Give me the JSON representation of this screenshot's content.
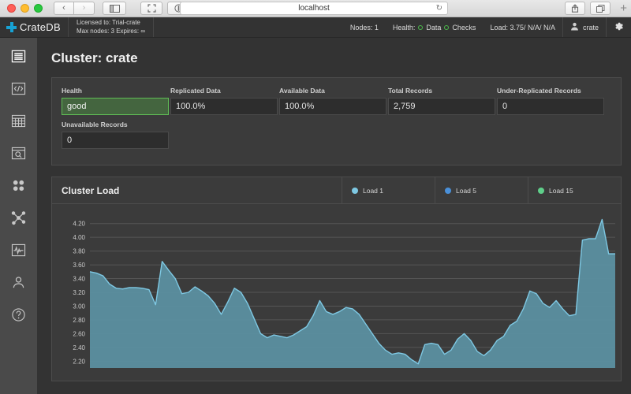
{
  "browser": {
    "url": "localhost",
    "back_icon": "‹",
    "forward_icon": "›",
    "sidebar_icon": "sidebar",
    "fullscreen_icon": "expand",
    "reader_icon": "reader",
    "reload_icon": "↻",
    "share_icon": "share",
    "tabs_icon": "tabs",
    "new_tab_icon": "+"
  },
  "appbar": {
    "logo_text": "CrateDB",
    "license_line1": "Licensed to: Trial-crate",
    "license_line2": "Max nodes: 3 Expires: ∞",
    "nodes": "Nodes: 1",
    "health_label": "Health:",
    "health_data": "Data",
    "health_checks": "Checks",
    "load": "Load: 3.75/ N/A/ N/A",
    "user": "crate",
    "gear_icon": "gear-icon",
    "ok_color": "#4cbb4c",
    "brand_color": "#17a2d4"
  },
  "sidebar": {
    "items": [
      {
        "name": "overview",
        "icon": "overview-icon",
        "active": true
      },
      {
        "name": "console",
        "icon": "code-console-icon",
        "active": false
      },
      {
        "name": "tables",
        "icon": "table-grid-icon",
        "active": false
      },
      {
        "name": "query-inspector",
        "icon": "search-window-icon",
        "active": false
      },
      {
        "name": "nodes",
        "icon": "four-dots-icon",
        "active": false
      },
      {
        "name": "shards",
        "icon": "network-nodes-icon",
        "active": false
      },
      {
        "name": "monitoring",
        "icon": "pulse-chart-icon",
        "active": false
      },
      {
        "name": "user",
        "icon": "user-icon",
        "active": false
      },
      {
        "name": "help",
        "icon": "help-circle-icon",
        "active": false
      }
    ]
  },
  "page": {
    "title": "Cluster: crate"
  },
  "stats": [
    {
      "label": "Health",
      "value": "good",
      "status": "good"
    },
    {
      "label": "Replicated Data",
      "value": "100.0%",
      "status": "normal"
    },
    {
      "label": "Available Data",
      "value": "100.0%",
      "status": "normal"
    },
    {
      "label": "Total Records",
      "value": "2,759",
      "status": "normal"
    },
    {
      "label": "Under-Replicated Records",
      "value": "0",
      "status": "normal"
    },
    {
      "label": "Unavailable Records",
      "value": "0",
      "status": "normal"
    }
  ],
  "chart_panel": {
    "title": "Cluster Load",
    "legend": [
      {
        "label": "Load 1",
        "color": "#7ec8e3"
      },
      {
        "label": "Load 5",
        "color": "#4a90d9"
      },
      {
        "label": "Load 15",
        "color": "#5fcf8a"
      }
    ]
  },
  "chart_data": {
    "type": "area",
    "title": "Cluster Load",
    "xlabel": "",
    "ylabel": "",
    "ylim": [
      2.1,
      4.3
    ],
    "yticks": [
      2.2,
      2.4,
      2.6,
      2.8,
      3.0,
      3.2,
      3.4,
      3.6,
      3.8,
      4.0,
      4.2
    ],
    "ytick_labels": [
      "2.20",
      "2.40",
      "2.60",
      "2.80",
      "3.00",
      "3.20",
      "3.40",
      "3.60",
      "3.80",
      "4.00",
      "4.20"
    ],
    "grid": true,
    "legend_position": "top-right",
    "series": [
      {
        "name": "Load 1",
        "color": "#7ec8e3",
        "fill": "#5b8fa0",
        "values": [
          3.5,
          3.48,
          3.44,
          3.32,
          3.26,
          3.25,
          3.27,
          3.27,
          3.26,
          3.24,
          3.02,
          3.65,
          3.52,
          3.4,
          3.18,
          3.2,
          3.28,
          3.22,
          3.15,
          3.04,
          2.88,
          3.06,
          3.26,
          3.2,
          3.04,
          2.82,
          2.6,
          2.54,
          2.58,
          2.56,
          2.54,
          2.58,
          2.64,
          2.7,
          2.86,
          3.08,
          2.92,
          2.88,
          2.92,
          2.98,
          2.96,
          2.88,
          2.74,
          2.6,
          2.46,
          2.36,
          2.3,
          2.32,
          2.3,
          2.22,
          2.16,
          2.44,
          2.46,
          2.44,
          2.3,
          2.36,
          2.52,
          2.6,
          2.5,
          2.34,
          2.28,
          2.36,
          2.5,
          2.56,
          2.72,
          2.78,
          2.96,
          3.22,
          3.18,
          3.04,
          2.98,
          3.08,
          2.96,
          2.86,
          2.88,
          3.96,
          3.98,
          3.98,
          4.26,
          3.76,
          3.76
        ]
      }
    ]
  }
}
